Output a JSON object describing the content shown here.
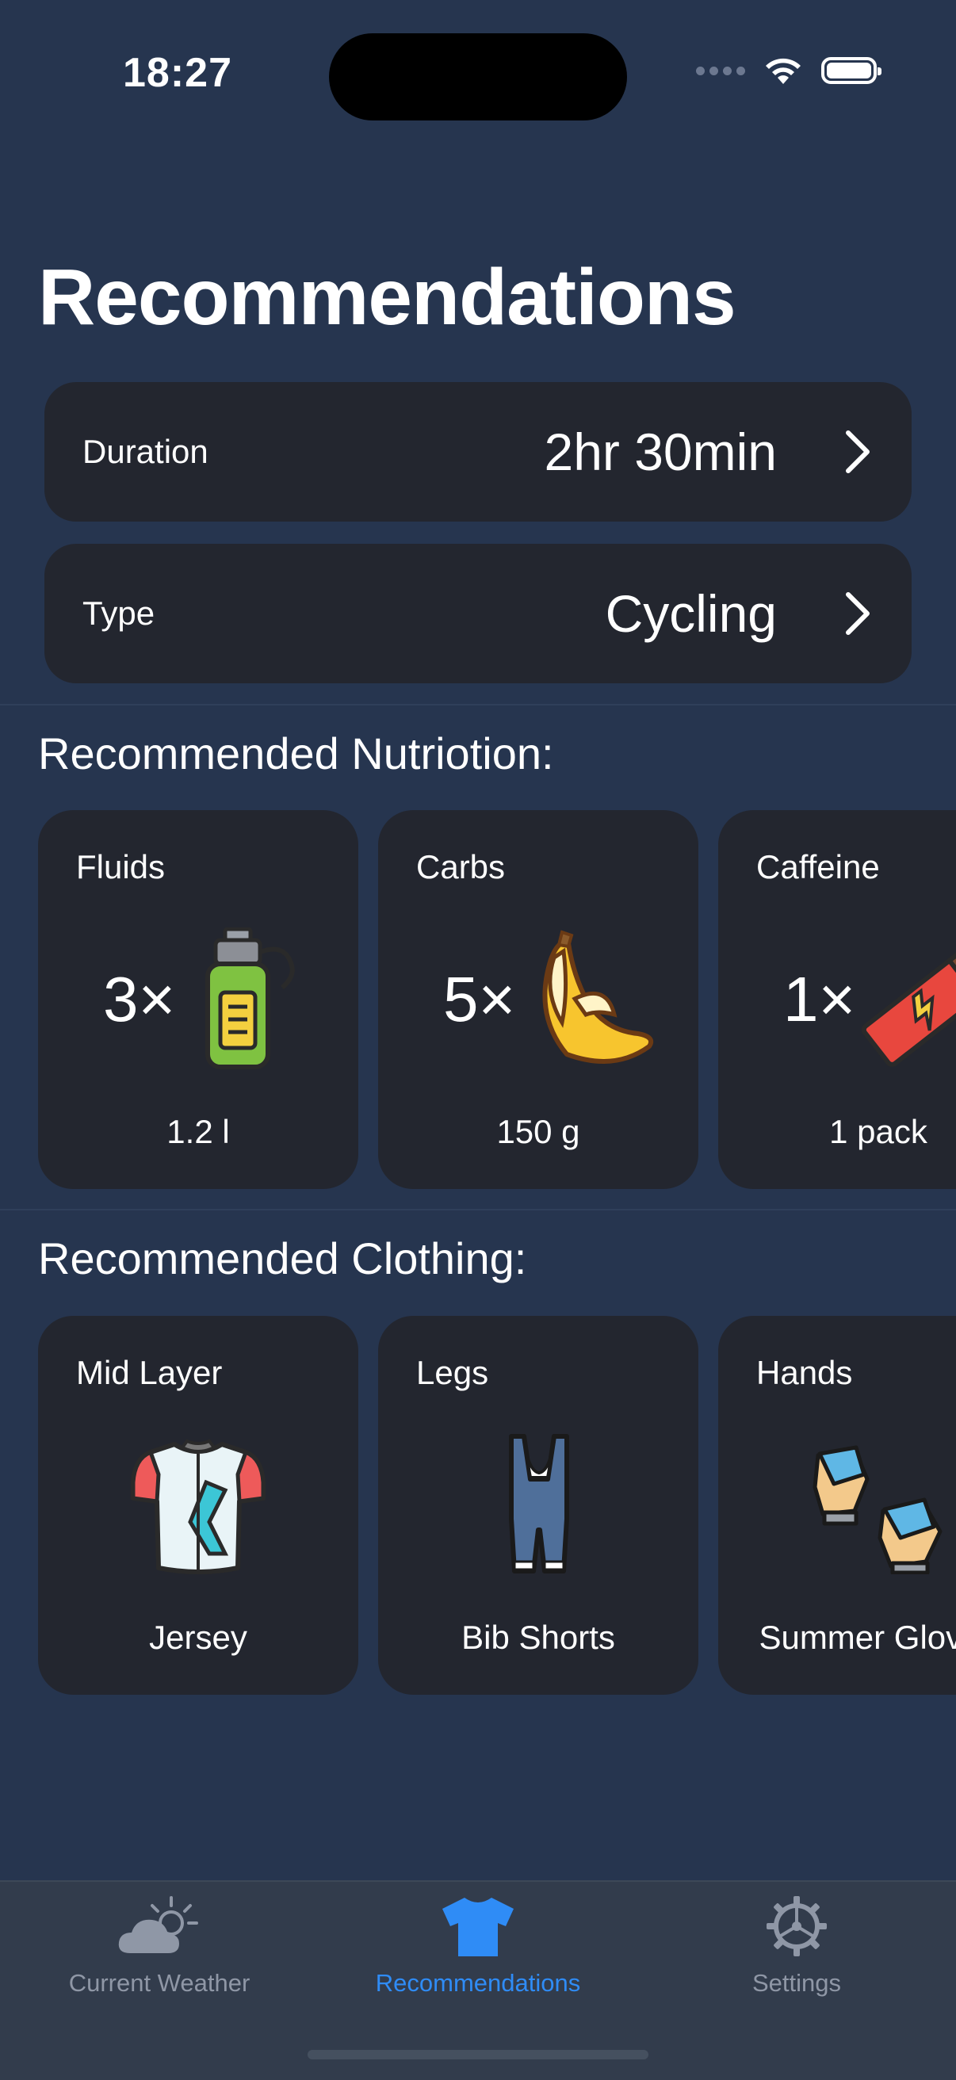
{
  "status": {
    "time": "18:27"
  },
  "page": {
    "title": "Recommendations"
  },
  "settings": [
    {
      "label": "Duration",
      "value": "2hr 30min"
    },
    {
      "label": "Type",
      "value": "Cycling"
    }
  ],
  "nutrition": {
    "heading": "Recommended Nutriotion:",
    "items": [
      {
        "title": "Fluids",
        "qty": "3×",
        "amount": "1.2 l",
        "icon": "water-bottle-icon"
      },
      {
        "title": "Carbs",
        "qty": "5×",
        "amount": "150 g",
        "icon": "banana-icon"
      },
      {
        "title": "Caffeine",
        "qty": "1×",
        "amount": "1 pack",
        "icon": "energy-bar-icon"
      }
    ]
  },
  "clothing": {
    "heading": "Recommended Clothing:",
    "items": [
      {
        "title": "Mid Layer",
        "name": "Jersey",
        "icon": "jersey-icon"
      },
      {
        "title": "Legs",
        "name": "Bib Shorts",
        "icon": "bib-shorts-icon"
      },
      {
        "title": "Hands",
        "name": "Summer Gloves",
        "icon": "gloves-icon"
      }
    ]
  },
  "tabs": [
    {
      "label": "Current Weather",
      "icon": "weather-icon",
      "active": false
    },
    {
      "label": "Recommendations",
      "icon": "shirt-icon",
      "active": true
    },
    {
      "label": "Settings",
      "icon": "gear-icon",
      "active": false
    }
  ],
  "colors": {
    "background": "#26354f",
    "card": "#23262f",
    "accent": "#2f8cf6",
    "tab_inactive": "#8f97a6"
  }
}
